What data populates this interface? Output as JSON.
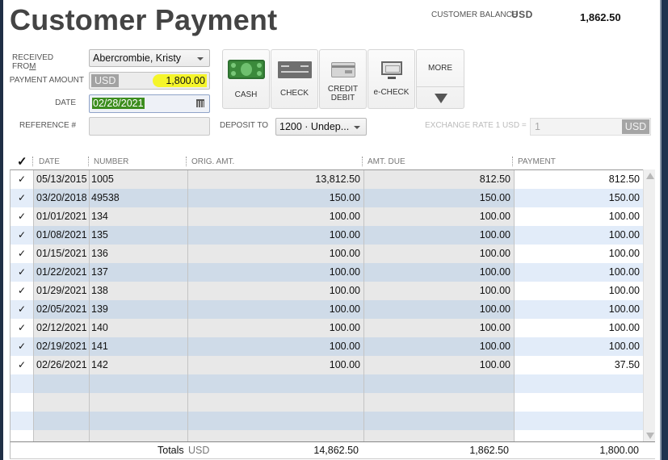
{
  "header": {
    "title": "Customer Payment",
    "balance_label": "CUSTOMER BALANCE",
    "balance_currency": "USD",
    "balance_value": "1,862.50"
  },
  "form": {
    "received_from": {
      "label_prefix": "RECEIVED FRO",
      "label_accel": "M",
      "value": "Abercrombie, Kristy"
    },
    "payment_amount": {
      "label": "PAYMENT AMOUNT",
      "currency": "USD",
      "value": "1,800.00"
    },
    "date": {
      "label": "DATE",
      "value": "02/28/2021"
    },
    "reference": {
      "label": "REFERENCE #",
      "value": ""
    },
    "deposit_to": {
      "label": "DEPOSIT TO",
      "value": "1200 · Undep..."
    },
    "exchange_rate": {
      "label": "EXCHANGE RATE 1 USD =",
      "value": "1",
      "currency": "USD"
    }
  },
  "payment_methods": [
    {
      "label": "CASH",
      "icon": "cash-icon"
    },
    {
      "label": "CHECK",
      "icon": "check-icon"
    },
    {
      "label": "CREDIT DEBIT",
      "line1": "CREDIT",
      "line2": "DEBIT",
      "icon": "credit-card-icon"
    },
    {
      "label": "e-CHECK",
      "icon": "monitor-icon"
    }
  ],
  "more_button": {
    "label": "MORE",
    "icon": "triangle-down-icon"
  },
  "table": {
    "columns": [
      "✓",
      "DATE",
      "NUMBER",
      "ORIG. AMT.",
      "AMT. DUE",
      "PAYMENT"
    ],
    "rows": [
      {
        "checked": "✓",
        "date": "05/13/2015",
        "number": "1005",
        "orig": "13,812.50",
        "due": "812.50",
        "payment": "812.50"
      },
      {
        "checked": "✓",
        "date": "03/20/2018",
        "number": "49538",
        "orig": "150.00",
        "due": "150.00",
        "payment": "150.00"
      },
      {
        "checked": "✓",
        "date": "01/01/2021",
        "number": "134",
        "orig": "100.00",
        "due": "100.00",
        "payment": "100.00"
      },
      {
        "checked": "✓",
        "date": "01/08/2021",
        "number": "135",
        "orig": "100.00",
        "due": "100.00",
        "payment": "100.00"
      },
      {
        "checked": "✓",
        "date": "01/15/2021",
        "number": "136",
        "orig": "100.00",
        "due": "100.00",
        "payment": "100.00"
      },
      {
        "checked": "✓",
        "date": "01/22/2021",
        "number": "137",
        "orig": "100.00",
        "due": "100.00",
        "payment": "100.00"
      },
      {
        "checked": "✓",
        "date": "01/29/2021",
        "number": "138",
        "orig": "100.00",
        "due": "100.00",
        "payment": "100.00"
      },
      {
        "checked": "✓",
        "date": "02/05/2021",
        "number": "139",
        "orig": "100.00",
        "due": "100.00",
        "payment": "100.00"
      },
      {
        "checked": "✓",
        "date": "02/12/2021",
        "number": "140",
        "orig": "100.00",
        "due": "100.00",
        "payment": "100.00"
      },
      {
        "checked": "✓",
        "date": "02/19/2021",
        "number": "141",
        "orig": "100.00",
        "due": "100.00",
        "payment": "100.00"
      },
      {
        "checked": "✓",
        "date": "02/26/2021",
        "number": "142",
        "orig": "100.00",
        "due": "100.00",
        "payment": "37.50"
      },
      {
        "checked": "",
        "date": "",
        "number": "",
        "orig": "",
        "due": "",
        "payment": ""
      },
      {
        "checked": "",
        "date": "",
        "number": "",
        "orig": "",
        "due": "",
        "payment": ""
      },
      {
        "checked": "",
        "date": "",
        "number": "",
        "orig": "",
        "due": "",
        "payment": ""
      },
      {
        "checked": "",
        "date": "",
        "number": "",
        "orig": "",
        "due": "",
        "payment": ""
      }
    ],
    "totals": {
      "label": "Totals",
      "currency": "USD",
      "orig": "14,862.50",
      "due": "1,862.50",
      "payment": "1,800.00"
    }
  },
  "colors": {
    "highlight_yellow": "#f5f52a",
    "date_selection_green": "#3c8d1e",
    "row_alt_blue": "#cfdbe8",
    "frame_navy": "#1f3350"
  }
}
